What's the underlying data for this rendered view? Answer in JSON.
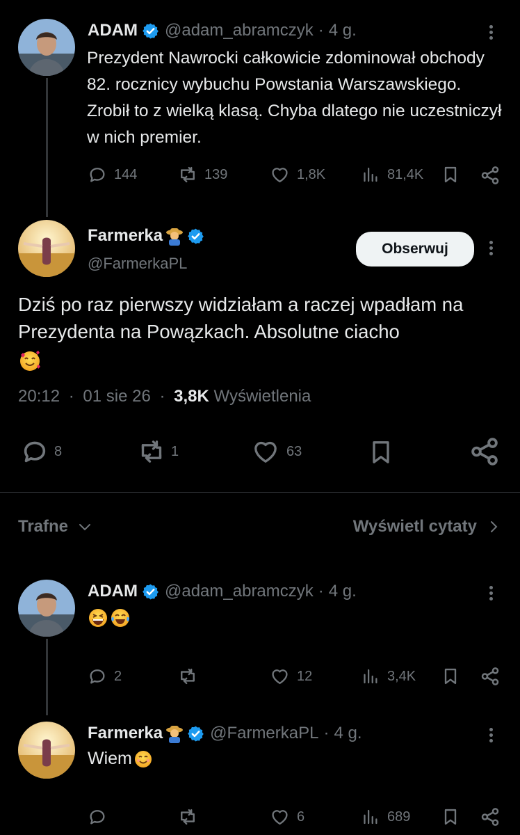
{
  "colors": {
    "background": "#000000",
    "text": "#e7e9ea",
    "muted": "#71767b",
    "verified": "#1d9bf0",
    "divider": "#2f3336"
  },
  "tweet1": {
    "author": "ADAM",
    "handle": "@adam_abramczyk",
    "time": "4 g.",
    "text": "Prezydent Nawrocki całkowicie zdominował obchody 82. rocznicy wybuchu Powstania Warszawskiego. Zrobił to z wielką klasą. Chyba dlatego nie uczestniczył w nich premier.",
    "replies": "144",
    "reposts": "139",
    "likes": "1,8K",
    "views": "81,4K"
  },
  "main": {
    "author": "Farmerka",
    "handle": "@FarmerkaPL",
    "follow_label": "Obserwuj",
    "text": "Dziś po raz pierwszy widziałam a raczej wpadłam na Prezydenta na Powązkach. Absolutne ciacho",
    "text_emoji": "smiling-face-with-hearts",
    "time": "20:12",
    "date": "01 sie 26",
    "views_count": "3,8K",
    "views_label": "Wyświetlenia",
    "replies": "8",
    "reposts": "1",
    "likes": "63"
  },
  "filter": {
    "sort_label": "Trafne",
    "quotes_label": "Wyświetl cytaty"
  },
  "reply1": {
    "author": "ADAM",
    "handle": "@adam_abramczyk",
    "time": "4 g.",
    "emojis": [
      "grinning-squinting-face",
      "face-with-tears-of-joy"
    ],
    "replies": "2",
    "reposts": "",
    "likes": "12",
    "views": "3,4K"
  },
  "reply2": {
    "author": "Farmerka",
    "handle": "@FarmerkaPL",
    "time": "4 g.",
    "text": "Wiem",
    "emoji": "smiling-face",
    "replies": "",
    "reposts": "",
    "likes": "6",
    "views": "689"
  },
  "icons": {
    "verified": "verified-badge-icon",
    "farmer": "farmer-emoji-icon",
    "more": "more-dots-icon",
    "reply": "reply-icon",
    "repost": "repost-icon",
    "like": "heart-icon",
    "views": "views-icon",
    "bookmark": "bookmark-icon",
    "share": "share-icon"
  }
}
